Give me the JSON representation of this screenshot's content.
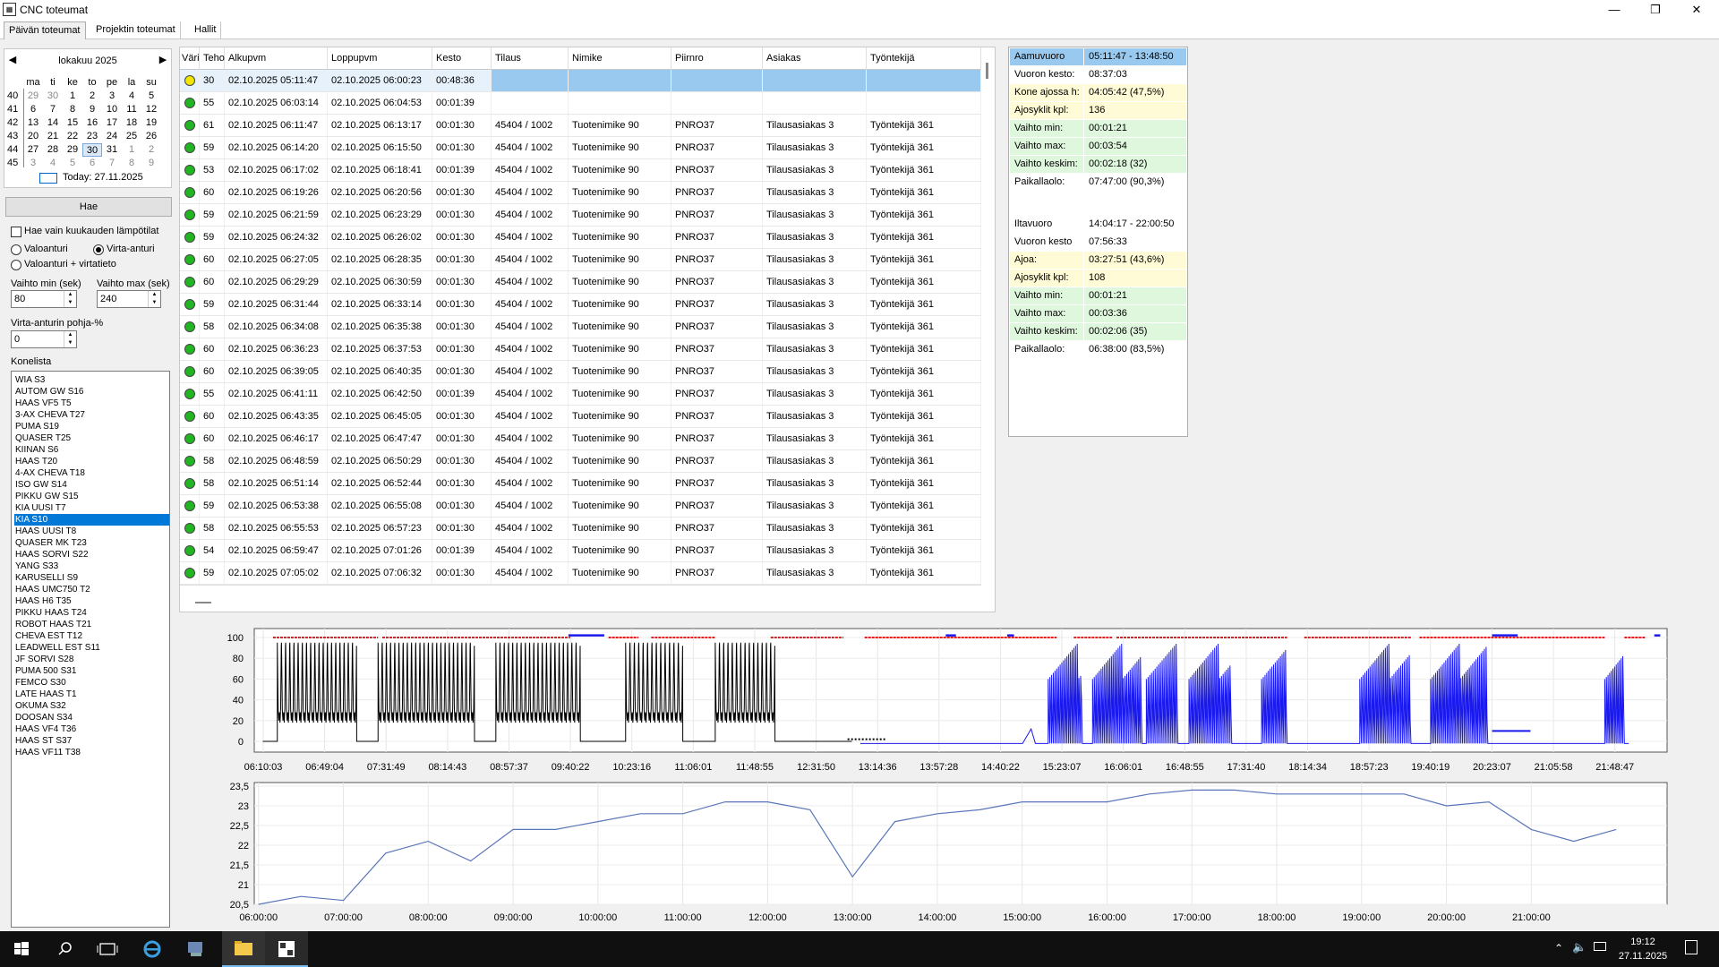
{
  "window": {
    "title": "CNC toteumat",
    "minimize_icon": "minimize-icon",
    "maximize_icon": "restore-icon",
    "close_icon": "close-icon"
  },
  "tabs": [
    {
      "label": "Päivän toteumat"
    },
    {
      "label": "Projektin toteumat"
    },
    {
      "label": "Hallit"
    }
  ],
  "calendar": {
    "month_label": "lokakuu 2025",
    "weekdays": [
      "ma",
      "ti",
      "ke",
      "to",
      "pe",
      "la",
      "su"
    ],
    "weeks": [
      {
        "no": "40",
        "days": [
          "29",
          "30",
          "1",
          "2",
          "3",
          "4",
          "5"
        ]
      },
      {
        "no": "41",
        "days": [
          "6",
          "7",
          "8",
          "9",
          "10",
          "11",
          "12"
        ]
      },
      {
        "no": "42",
        "days": [
          "13",
          "14",
          "15",
          "16",
          "17",
          "18",
          "19"
        ]
      },
      {
        "no": "43",
        "days": [
          "20",
          "21",
          "22",
          "23",
          "24",
          "25",
          "26"
        ]
      },
      {
        "no": "44",
        "days": [
          "27",
          "28",
          "29",
          "30",
          "31",
          "1",
          "2"
        ]
      },
      {
        "no": "45",
        "days": [
          "3",
          "4",
          "5",
          "6",
          "7",
          "8",
          "9"
        ]
      }
    ],
    "selected_day": "30",
    "today_label": "Today: 27.11.2025"
  },
  "controls": {
    "search_button": "Hae",
    "only_month_temps": "Hae vain kuukauden lämpötilat",
    "radio_light": "Valoanturi",
    "radio_current": "Virta-anturi",
    "radio_light_current": "Valoanturi + virtatieto",
    "min_label": "Vaihto min (sek)",
    "min_value": "80",
    "max_label": "Vaihto max (sek)",
    "max_value": "240",
    "base_label": "Virta-anturin pohja-%",
    "base_value": "0",
    "machines_label": "Konelista"
  },
  "machines": [
    "WIA S3",
    "AUTOM GW S16",
    "HAAS VF5 T5",
    "3-AX CHEVA T27",
    "PUMA S19",
    "QUASER T25",
    "KIINAN S6",
    "HAAS T20",
    "4-AX CHEVA T18",
    "ISO GW S14",
    "PIKKU GW S15",
    "KIA UUSI T7",
    "KIA S10",
    "HAAS UUSI T8",
    "QUASER MK T23",
    "HAAS SORVI S22",
    "YANG S33",
    "KARUSELLI S9",
    "HAAS UMC750 T2",
    "HAAS H6 T35",
    "PIKKU HAAS T24",
    "ROBOT HAAS T21",
    "CHEVA EST T12",
    "LEADWELL EST S11",
    "JF SORVI S28",
    "PUMA 500 S31",
    "FEMCO S30",
    "LATE HAAS T1",
    "OKUMA S32",
    "DOOSAN S34",
    "HAAS VF4 T36",
    "HAAS ST S37",
    "HAAS VF11 T38"
  ],
  "selected_machine": "KIA S10",
  "grid": {
    "headers": [
      "Väri",
      "Teho",
      "Alkupvm",
      "Loppupvm",
      "Kesto",
      "Tilaus",
      "Nimike",
      "Piirnro",
      "Asiakas",
      "Työntekijä"
    ],
    "rows": [
      {
        "color": "#f2e600",
        "teho": "30",
        "alku": "02.10.2025 05:11:47",
        "loppu": "02.10.2025 06:00:23",
        "kesto": "00:48:36",
        "tilaus": "",
        "nimike": "",
        "piirnro": "",
        "asiakas": "",
        "tyontekija": ""
      },
      {
        "color": "#22b522",
        "teho": "55",
        "alku": "02.10.2025 06:03:14",
        "loppu": "02.10.2025 06:04:53",
        "kesto": "00:01:39",
        "tilaus": "",
        "nimike": "",
        "piirnro": "",
        "asiakas": "",
        "tyontekija": ""
      },
      {
        "color": "#22b522",
        "teho": "61",
        "alku": "02.10.2025 06:11:47",
        "loppu": "02.10.2025 06:13:17",
        "kesto": "00:01:30",
        "tilaus": "45404 / 1002",
        "nimike": "Tuotenimike 90",
        "piirnro": "PNRO37",
        "asiakas": "Tilausasiakas 3",
        "tyontekija": "Työntekijä 361"
      },
      {
        "color": "#22b522",
        "teho": "59",
        "alku": "02.10.2025 06:14:20",
        "loppu": "02.10.2025 06:15:50",
        "kesto": "00:01:30",
        "tilaus": "45404 / 1002",
        "nimike": "Tuotenimike 90",
        "piirnro": "PNRO37",
        "asiakas": "Tilausasiakas 3",
        "tyontekija": "Työntekijä 361"
      },
      {
        "color": "#22b522",
        "teho": "53",
        "alku": "02.10.2025 06:17:02",
        "loppu": "02.10.2025 06:18:41",
        "kesto": "00:01:39",
        "tilaus": "45404 / 1002",
        "nimike": "Tuotenimike 90",
        "piirnro": "PNRO37",
        "asiakas": "Tilausasiakas 3",
        "tyontekija": "Työntekijä 361"
      },
      {
        "color": "#22b522",
        "teho": "60",
        "alku": "02.10.2025 06:19:26",
        "loppu": "02.10.2025 06:20:56",
        "kesto": "00:01:30",
        "tilaus": "45404 / 1002",
        "nimike": "Tuotenimike 90",
        "piirnro": "PNRO37",
        "asiakas": "Tilausasiakas 3",
        "tyontekija": "Työntekijä 361"
      },
      {
        "color": "#22b522",
        "teho": "59",
        "alku": "02.10.2025 06:21:59",
        "loppu": "02.10.2025 06:23:29",
        "kesto": "00:01:30",
        "tilaus": "45404 / 1002",
        "nimike": "Tuotenimike 90",
        "piirnro": "PNRO37",
        "asiakas": "Tilausasiakas 3",
        "tyontekija": "Työntekijä 361"
      },
      {
        "color": "#22b522",
        "teho": "59",
        "alku": "02.10.2025 06:24:32",
        "loppu": "02.10.2025 06:26:02",
        "kesto": "00:01:30",
        "tilaus": "45404 / 1002",
        "nimike": "Tuotenimike 90",
        "piirnro": "PNRO37",
        "asiakas": "Tilausasiakas 3",
        "tyontekija": "Työntekijä 361"
      },
      {
        "color": "#22b522",
        "teho": "60",
        "alku": "02.10.2025 06:27:05",
        "loppu": "02.10.2025 06:28:35",
        "kesto": "00:01:30",
        "tilaus": "45404 / 1002",
        "nimike": "Tuotenimike 90",
        "piirnro": "PNRO37",
        "asiakas": "Tilausasiakas 3",
        "tyontekija": "Työntekijä 361"
      },
      {
        "color": "#22b522",
        "teho": "60",
        "alku": "02.10.2025 06:29:29",
        "loppu": "02.10.2025 06:30:59",
        "kesto": "00:01:30",
        "tilaus": "45404 / 1002",
        "nimike": "Tuotenimike 90",
        "piirnro": "PNRO37",
        "asiakas": "Tilausasiakas 3",
        "tyontekija": "Työntekijä 361"
      },
      {
        "color": "#22b522",
        "teho": "59",
        "alku": "02.10.2025 06:31:44",
        "loppu": "02.10.2025 06:33:14",
        "kesto": "00:01:30",
        "tilaus": "45404 / 1002",
        "nimike": "Tuotenimike 90",
        "piirnro": "PNRO37",
        "asiakas": "Tilausasiakas 3",
        "tyontekija": "Työntekijä 361"
      },
      {
        "color": "#22b522",
        "teho": "58",
        "alku": "02.10.2025 06:34:08",
        "loppu": "02.10.2025 06:35:38",
        "kesto": "00:01:30",
        "tilaus": "45404 / 1002",
        "nimike": "Tuotenimike 90",
        "piirnro": "PNRO37",
        "asiakas": "Tilausasiakas 3",
        "tyontekija": "Työntekijä 361"
      },
      {
        "color": "#22b522",
        "teho": "60",
        "alku": "02.10.2025 06:36:23",
        "loppu": "02.10.2025 06:37:53",
        "kesto": "00:01:30",
        "tilaus": "45404 / 1002",
        "nimike": "Tuotenimike 90",
        "piirnro": "PNRO37",
        "asiakas": "Tilausasiakas 3",
        "tyontekija": "Työntekijä 361"
      },
      {
        "color": "#22b522",
        "teho": "60",
        "alku": "02.10.2025 06:39:05",
        "loppu": "02.10.2025 06:40:35",
        "kesto": "00:01:30",
        "tilaus": "45404 / 1002",
        "nimike": "Tuotenimike 90",
        "piirnro": "PNRO37",
        "asiakas": "Tilausasiakas 3",
        "tyontekija": "Työntekijä 361"
      },
      {
        "color": "#22b522",
        "teho": "55",
        "alku": "02.10.2025 06:41:11",
        "loppu": "02.10.2025 06:42:50",
        "kesto": "00:01:39",
        "tilaus": "45404 / 1002",
        "nimike": "Tuotenimike 90",
        "piirnro": "PNRO37",
        "asiakas": "Tilausasiakas 3",
        "tyontekija": "Työntekijä 361"
      },
      {
        "color": "#22b522",
        "teho": "60",
        "alku": "02.10.2025 06:43:35",
        "loppu": "02.10.2025 06:45:05",
        "kesto": "00:01:30",
        "tilaus": "45404 / 1002",
        "nimike": "Tuotenimike 90",
        "piirnro": "PNRO37",
        "asiakas": "Tilausasiakas 3",
        "tyontekija": "Työntekijä 361"
      },
      {
        "color": "#22b522",
        "teho": "60",
        "alku": "02.10.2025 06:46:17",
        "loppu": "02.10.2025 06:47:47",
        "kesto": "00:01:30",
        "tilaus": "45404 / 1002",
        "nimike": "Tuotenimike 90",
        "piirnro": "PNRO37",
        "asiakas": "Tilausasiakas 3",
        "tyontekija": "Työntekijä 361"
      },
      {
        "color": "#22b522",
        "teho": "58",
        "alku": "02.10.2025 06:48:59",
        "loppu": "02.10.2025 06:50:29",
        "kesto": "00:01:30",
        "tilaus": "45404 / 1002",
        "nimike": "Tuotenimike 90",
        "piirnro": "PNRO37",
        "asiakas": "Tilausasiakas 3",
        "tyontekija": "Työntekijä 361"
      },
      {
        "color": "#22b522",
        "teho": "58",
        "alku": "02.10.2025 06:51:14",
        "loppu": "02.10.2025 06:52:44",
        "kesto": "00:01:30",
        "tilaus": "45404 / 1002",
        "nimike": "Tuotenimike 90",
        "piirnro": "PNRO37",
        "asiakas": "Tilausasiakas 3",
        "tyontekija": "Työntekijä 361"
      },
      {
        "color": "#22b522",
        "teho": "59",
        "alku": "02.10.2025 06:53:38",
        "loppu": "02.10.2025 06:55:08",
        "kesto": "00:01:30",
        "tilaus": "45404 / 1002",
        "nimike": "Tuotenimike 90",
        "piirnro": "PNRO37",
        "asiakas": "Tilausasiakas 3",
        "tyontekija": "Työntekijä 361"
      },
      {
        "color": "#22b522",
        "teho": "58",
        "alku": "02.10.2025 06:55:53",
        "loppu": "02.10.2025 06:57:23",
        "kesto": "00:01:30",
        "tilaus": "45404 / 1002",
        "nimike": "Tuotenimike 90",
        "piirnro": "PNRO37",
        "asiakas": "Tilausasiakas 3",
        "tyontekija": "Työntekijä 361"
      },
      {
        "color": "#22b522",
        "teho": "54",
        "alku": "02.10.2025 06:59:47",
        "loppu": "02.10.2025 07:01:26",
        "kesto": "00:01:39",
        "tilaus": "45404 / 1002",
        "nimike": "Tuotenimike 90",
        "piirnro": "PNRO37",
        "asiakas": "Tilausasiakas 3",
        "tyontekija": "Työntekijä 361"
      },
      {
        "color": "#22b522",
        "teho": "59",
        "alku": "02.10.2025 07:05:02",
        "loppu": "02.10.2025 07:06:32",
        "kesto": "00:01:30",
        "tilaus": "45404 / 1002",
        "nimike": "Tuotenimike 90",
        "piirnro": "PNRO37",
        "asiakas": "Tilausasiakas 3",
        "tyontekija": "Työntekijä 361"
      }
    ]
  },
  "summary": {
    "rows": [
      {
        "key": "Aamuvuoro",
        "value": "05:11:47 - 13:48:50",
        "style": "sel"
      },
      {
        "key": "Vuoron kesto:",
        "value": "08:37:03",
        "style": ""
      },
      {
        "key": "Kone ajossa h:",
        "value": "04:05:42 (47,5%)",
        "style": "yellow"
      },
      {
        "key": "Ajosyklit kpl:",
        "value": "136",
        "style": "yellow"
      },
      {
        "key": "Vaihto min:",
        "value": "00:01:21",
        "style": "green"
      },
      {
        "key": "Vaihto max:",
        "value": "00:03:54",
        "style": "green"
      },
      {
        "key": "Vaihto keskim:",
        "value": "00:02:18 (32)",
        "style": "green"
      },
      {
        "key": "Paikallaolo:",
        "value": "07:47:00 (90,3%)",
        "style": ""
      },
      {
        "key": "",
        "value": "",
        "style": ""
      },
      {
        "key": "Iltavuoro",
        "value": "14:04:17 - 22:00:50",
        "style": ""
      },
      {
        "key": "Vuoron kesto",
        "value": "07:56:33",
        "style": ""
      },
      {
        "key": "Ajoa:",
        "value": "03:27:51 (43,6%)",
        "style": "yellow"
      },
      {
        "key": "Ajosyklit kpl:",
        "value": "108",
        "style": "yellow"
      },
      {
        "key": "Vaihto min:",
        "value": "00:01:21",
        "style": "green"
      },
      {
        "key": "Vaihto max:",
        "value": "00:03:36",
        "style": "green"
      },
      {
        "key": "Vaihto keskim:",
        "value": "00:02:06 (35)",
        "style": "green"
      },
      {
        "key": "Paikallaolo:",
        "value": "06:38:00 (83,5%)",
        "style": ""
      }
    ]
  },
  "colors": {
    "selected": "#0078d7",
    "row_highlight": "#99c9ef",
    "summary_yellow": "#fffbd6",
    "summary_green": "#dff7dd",
    "summary_sel": "#99c9ef",
    "series_black": "#000000",
    "series_blue": "#1a1aee",
    "series_red": "#e81c1c",
    "temp_line": "#5a76b8"
  },
  "chart_data": [
    {
      "type": "line",
      "ylim": [
        0,
        100
      ],
      "yticks": [
        "100",
        "80",
        "60",
        "40",
        "20",
        "0"
      ],
      "xticks": [
        "06:10:03",
        "06:49:04",
        "07:31:49",
        "08:14:43",
        "08:57:37",
        "09:40:22",
        "10:23:16",
        "11:06:01",
        "11:48:55",
        "12:31:50",
        "13:14:36",
        "13:57:28",
        "14:40:22",
        "15:23:07",
        "16:06:01",
        "16:48:55",
        "17:31:40",
        "18:14:34",
        "18:57:23",
        "19:40:19",
        "20:23:07",
        "21:05:58",
        "21:48:47"
      ],
      "xrange_hours": [
        5.9,
        22.45
      ],
      "black_bursts": [
        [
          6.17,
          7.1
        ],
        [
          7.35,
          8.48
        ],
        [
          8.73,
          9.72
        ],
        [
          10.25,
          10.92
        ],
        [
          11.3,
          12.0
        ]
      ],
      "blue_bursts": [
        [
          15.2,
          15.6
        ],
        [
          15.72,
          16.3
        ],
        [
          16.35,
          16.72
        ],
        [
          16.85,
          17.35
        ],
        [
          17.7,
          18.0
        ],
        [
          18.85,
          19.45
        ],
        [
          19.68,
          20.35
        ],
        [
          21.72,
          21.95
        ]
      ],
      "blue_mid_segment": [
        20.4,
        20.85,
        10
      ],
      "red_segments": [
        [
          6.12,
          7.35
        ],
        [
          7.4,
          9.6
        ],
        [
          10.05,
          10.4
        ],
        [
          10.55,
          11.3
        ],
        [
          11.95,
          12.8
        ],
        [
          13.05,
          15.3
        ],
        [
          15.5,
          15.95
        ],
        [
          16.0,
          18.0
        ],
        [
          18.2,
          19.45
        ],
        [
          19.55,
          21.72
        ],
        [
          21.95,
          22.2
        ]
      ],
      "blue_top_marks": [
        [
          9.58,
          10.0
        ],
        [
          14.0,
          14.12
        ],
        [
          14.72,
          14.8
        ],
        [
          20.4,
          20.7
        ],
        [
          22.3,
          22.37
        ]
      ]
    },
    {
      "type": "line",
      "ylim": [
        20.5,
        23.5
      ],
      "yticks": [
        "23,5",
        "23",
        "22,5",
        "22",
        "21,5",
        "21",
        "20,5"
      ],
      "xticks": [
        "06:00:00",
        "07:00:00",
        "08:00:00",
        "09:00:00",
        "10:00:00",
        "11:00:00",
        "12:00:00",
        "13:00:00",
        "14:00:00",
        "15:00:00",
        "16:00:00",
        "17:00:00",
        "18:00:00",
        "19:00:00",
        "20:00:00",
        "21:00:00"
      ],
      "xrange_hours": [
        5.95,
        22.0
      ],
      "x": [
        6.0,
        6.5,
        7.0,
        7.5,
        8.0,
        8.5,
        9.0,
        9.5,
        10.0,
        10.5,
        11.0,
        11.5,
        12.0,
        12.5,
        13.0,
        13.5,
        14.0,
        14.5,
        15.0,
        15.5,
        16.0,
        16.5,
        17.0,
        17.5,
        18.0,
        18.5,
        19.0,
        19.5,
        20.0,
        20.5,
        21.0,
        21.5,
        22.0
      ],
      "y": [
        20.5,
        20.7,
        20.6,
        21.8,
        22.1,
        21.6,
        22.4,
        22.4,
        22.6,
        22.8,
        22.8,
        23.1,
        23.1,
        22.9,
        21.2,
        22.6,
        22.8,
        22.9,
        23.1,
        23.1,
        23.1,
        23.3,
        23.4,
        23.4,
        23.3,
        23.3,
        23.3,
        23.3,
        23.0,
        23.1,
        22.4,
        22.1,
        22.4
      ]
    }
  ],
  "taskbar": {
    "time": "19:12",
    "date": "27.11.2025"
  }
}
